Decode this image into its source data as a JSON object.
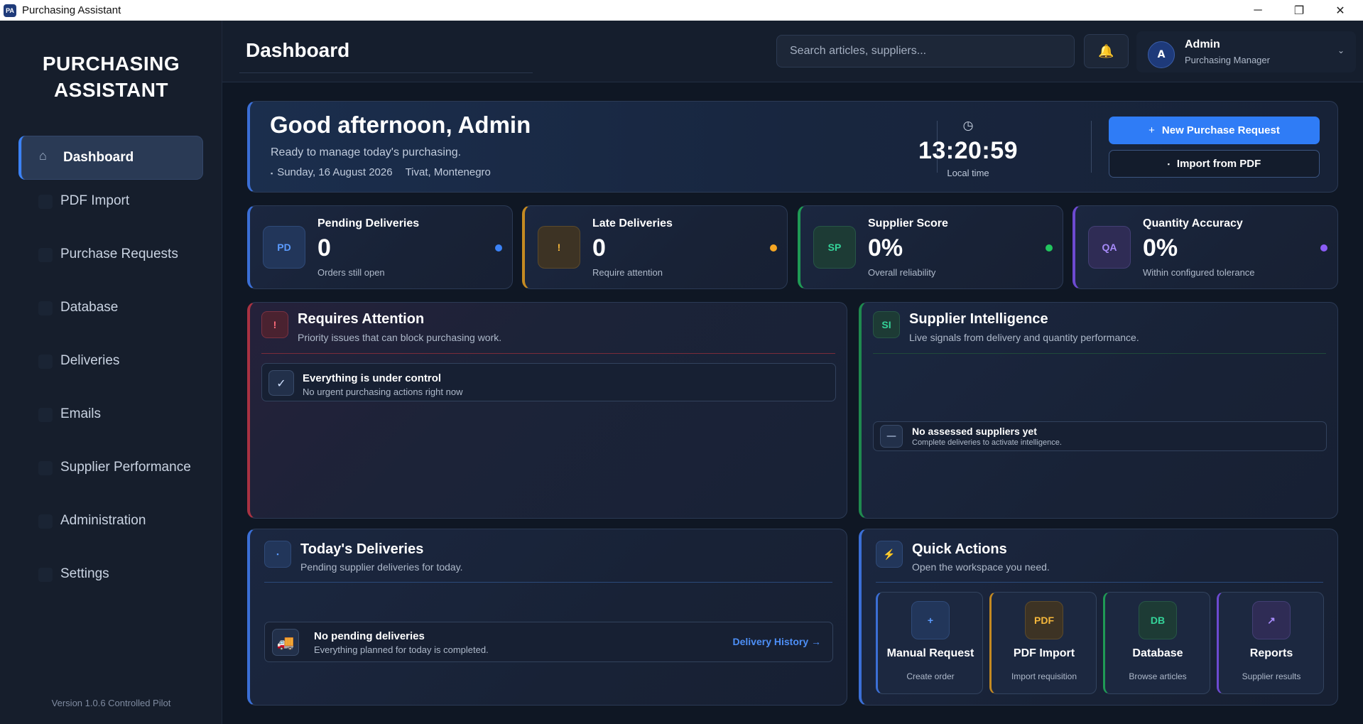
{
  "window": {
    "title": "Purchasing Assistant",
    "icon": "PA",
    "minimize": "─",
    "maximize": "❐",
    "close": "✕"
  },
  "sidebar": {
    "brand_line1": "PURCHASING",
    "brand_line2": "ASSISTANT",
    "items": [
      {
        "label": "Dashboard",
        "active": true
      },
      {
        "label": "PDF Import"
      },
      {
        "label": "Purchase Requests"
      },
      {
        "label": "Database"
      },
      {
        "label": "Deliveries"
      },
      {
        "label": "Emails"
      },
      {
        "label": "Supplier Performance"
      },
      {
        "label": "Administration"
      },
      {
        "label": "Settings"
      }
    ],
    "version": "Version 1.0.6 Controlled Pilot"
  },
  "header": {
    "title": "Dashboard",
    "search_placeholder": "Search articles, suppliers...",
    "bell_icon": "🔔",
    "user": {
      "initial": "A",
      "name": "Admin",
      "role": "Purchasing Manager",
      "chevron": "⌄"
    }
  },
  "welcome": {
    "greeting": "Good afternoon, Admin",
    "subtitle": "Ready to manage today's purchasing.",
    "calendar_icon": "▪",
    "date": "Sunday, 16 August 2026",
    "location": "Tivat, Montenegro",
    "clock_icon": "◷",
    "time": "13:20:59",
    "time_label": "Local time",
    "new_request_icon": "+",
    "new_request_label": "New Purchase Request",
    "import_icon": "▪",
    "import_label": "Import from PDF"
  },
  "kpis": [
    {
      "badge": "PD",
      "title": "Pending Deliveries",
      "value": "0",
      "sub": "Orders still open",
      "color": "#3b82f6"
    },
    {
      "badge": "!",
      "title": "Late Deliveries",
      "value": "0",
      "sub": "Require attention",
      "color": "#f5a623"
    },
    {
      "badge": "SP",
      "title": "Supplier Score",
      "value": "0%",
      "sub": "Overall reliability",
      "color": "#22c55e"
    },
    {
      "badge": "QA",
      "title": "Quantity Accuracy",
      "value": "0%",
      "sub": "Within configured tolerance",
      "color": "#8b5cf6"
    }
  ],
  "attention": {
    "badge": "!",
    "title": "Requires Attention",
    "subtitle": "Priority issues that can block purchasing work.",
    "status_icon": "✓",
    "status_title": "Everything is under control",
    "status_sub": "No urgent purchasing actions right now"
  },
  "intelligence": {
    "badge": "SI",
    "title": "Supplier Intelligence",
    "subtitle": "Live signals from delivery and quantity performance.",
    "status_icon": "—",
    "status_title": "No assessed suppliers yet",
    "status_sub": "Complete deliveries to activate intelligence."
  },
  "deliveries": {
    "badge": "▪",
    "title": "Today's Deliveries",
    "subtitle": "Pending supplier deliveries for today.",
    "status_icon": "🚚",
    "status_title": "No pending deliveries",
    "status_sub": "Everything planned for today is completed.",
    "link": "Delivery History →"
  },
  "quick_actions": {
    "badge": "⚡",
    "title": "Quick Actions",
    "subtitle": "Open the workspace you need.",
    "items": [
      {
        "badge": "+",
        "title": "Manual Request",
        "sub": "Create order",
        "color": "#3b82f6"
      },
      {
        "badge": "PDF",
        "title": "PDF Import",
        "sub": "Import requisition",
        "color": "#f5a623"
      },
      {
        "badge": "DB",
        "title": "Database",
        "sub": "Browse articles",
        "color": "#22c55e"
      },
      {
        "badge": "↗",
        "title": "Reports",
        "sub": "Supplier results",
        "color": "#8b5cf6"
      }
    ]
  }
}
